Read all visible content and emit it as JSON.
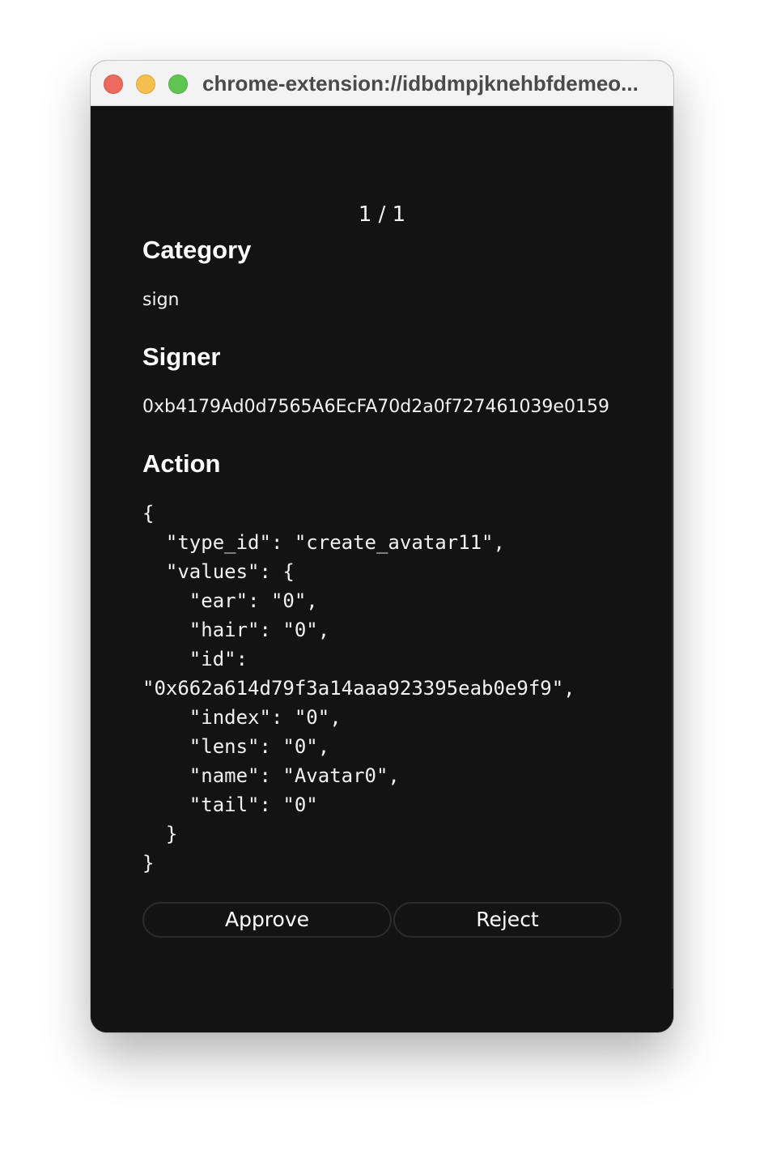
{
  "window": {
    "title": "chrome-extension://idbdmpjknehbfdemeo..."
  },
  "pager": {
    "label": "1 / 1"
  },
  "sections": {
    "category": {
      "heading": "Category",
      "value": "sign"
    },
    "signer": {
      "heading": "Signer",
      "value": "0xb4179Ad0d7565A6EcFA70d2a0f727461039e0159"
    },
    "action": {
      "heading": "Action",
      "json_text": "{\n  \"type_id\": \"create_avatar11\",\n  \"values\": {\n    \"ear\": \"0\",\n    \"hair\": \"0\",\n    \"id\":\n\"0x662a614d79f3a14aaa923395eab0e9f9\",\n    \"index\": \"0\",\n    \"lens\": \"0\",\n    \"name\": \"Avatar0\",\n    \"tail\": \"0\"\n  }\n}"
    }
  },
  "buttons": {
    "approve": "Approve",
    "reject": "Reject"
  },
  "colors": {
    "background": "#131313",
    "text": "#ffffff",
    "button_border": "#2c2c2c",
    "traffic_close": "#ec6a5e",
    "traffic_minimize": "#f4bf4f",
    "traffic_zoom": "#61c554"
  }
}
